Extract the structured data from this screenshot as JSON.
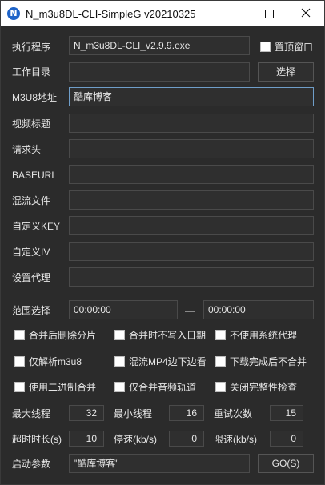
{
  "window": {
    "title": "N_m3u8DL-CLI-SimpleG v20210325",
    "icon_letter": "N"
  },
  "form": {
    "exe": {
      "label": "执行程序",
      "value": "N_m3u8DL-CLI_v2.9.9.exe"
    },
    "topmost": {
      "label": "置顶窗口",
      "checked": false
    },
    "workdir": {
      "label": "工作目录",
      "value": "",
      "button": "选择"
    },
    "m3u8": {
      "label": "M3U8地址",
      "value": "酷库博客"
    },
    "title": {
      "label": "视频标题",
      "value": ""
    },
    "headers": {
      "label": "请求头",
      "value": ""
    },
    "baseurl": {
      "label": "BASEURL",
      "value": ""
    },
    "mux": {
      "label": "混流文件",
      "value": ""
    },
    "key": {
      "label": "自定义KEY",
      "value": ""
    },
    "iv": {
      "label": "自定义IV",
      "value": ""
    },
    "proxy": {
      "label": "设置代理",
      "value": ""
    },
    "range": {
      "label": "范围选择",
      "start": "00:00:00",
      "separator": "—",
      "end": "00:00:00"
    }
  },
  "options": [
    {
      "label": "合并后删除分片",
      "checked": false
    },
    {
      "label": "合并时不写入日期",
      "checked": false
    },
    {
      "label": "不使用系统代理",
      "checked": false
    },
    {
      "label": "仅解析m3u8",
      "checked": false
    },
    {
      "label": "混流MP4边下边看",
      "checked": false
    },
    {
      "label": "下载完成后不合并",
      "checked": false
    },
    {
      "label": "使用二进制合并",
      "checked": false
    },
    {
      "label": "仅合并音频轨道",
      "checked": false
    },
    {
      "label": "关闭完整性检查",
      "checked": false
    }
  ],
  "numbers": {
    "max_threads": {
      "label": "最大线程",
      "value": "32"
    },
    "min_threads": {
      "label": "最小线程",
      "value": "16"
    },
    "retry": {
      "label": "重试次数",
      "value": "15"
    },
    "timeout": {
      "label": "超时时长(s)",
      "value": "10"
    },
    "stop_speed": {
      "label": "停速(kb/s)",
      "value": "0"
    },
    "limit_speed": {
      "label": "限速(kb/s)",
      "value": "0"
    }
  },
  "launch": {
    "label": "启动参数",
    "value": "\"酷库博客\"",
    "go_button": "GO(S)"
  },
  "colors": {
    "background": "#2b2b2b",
    "field_border": "#4a4a4a",
    "active_border": "#6f9ec9",
    "icon_blue": "#1e63c8"
  }
}
